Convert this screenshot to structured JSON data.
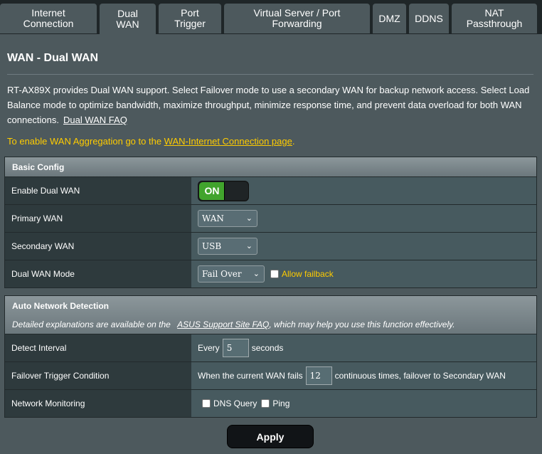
{
  "tabs": [
    {
      "line1": "Internet",
      "line2": "Connection"
    },
    {
      "line1": "Dual",
      "line2": "WAN"
    },
    {
      "line1": "Port",
      "line2": "Trigger"
    },
    {
      "line1": "Virtual Server / Port",
      "line2": "Forwarding"
    },
    {
      "line1": "DMZ",
      "line2": ""
    },
    {
      "line1": "DDNS",
      "line2": ""
    },
    {
      "line1": "NAT",
      "line2": "Passthrough"
    }
  ],
  "page": {
    "title": "WAN - Dual WAN",
    "intro": "RT-AX89X provides Dual WAN support. Select Failover mode to use a secondary WAN for backup network access. Select Load Balance mode to optimize bandwidth, maximize throughput, minimize response time, and prevent data overload for both WAN connections.",
    "faq_link": "Dual WAN FAQ",
    "agg_prefix": "To enable WAN Aggregation go to the ",
    "agg_link": "WAN-Internet Connection page",
    "agg_suffix": "."
  },
  "basic_config": {
    "header": "Basic Config",
    "enable_label": "Enable Dual WAN",
    "enable_state": "ON",
    "primary_label": "Primary WAN",
    "primary_value": "WAN",
    "secondary_label": "Secondary WAN",
    "secondary_value": "USB",
    "mode_label": "Dual WAN Mode",
    "mode_value": "Fail Over",
    "fallback_label": "Allow failback"
  },
  "auto_detect": {
    "header": "Auto Network Detection",
    "desc_prefix": "Detailed explanations are available on the",
    "desc_link": "ASUS Support Site FAQ",
    "desc_suffix": ", which may help you use this function effectively.",
    "interval_label": "Detect Interval",
    "interval_prefix": "Every",
    "interval_value": "5",
    "interval_suffix": "seconds",
    "trigger_label": "Failover Trigger Condition",
    "trigger_prefix": "When the current WAN fails",
    "trigger_value": "12",
    "trigger_suffix": "continuous times, failover to Secondary WAN",
    "monitor_label": "Network Monitoring",
    "dns_label": "DNS Query",
    "ping_label": "Ping"
  },
  "apply_label": "Apply",
  "colors": {
    "background": "#4d595d",
    "accent_yellow": "#ffcc00",
    "toggle_on": "#41a42d"
  }
}
